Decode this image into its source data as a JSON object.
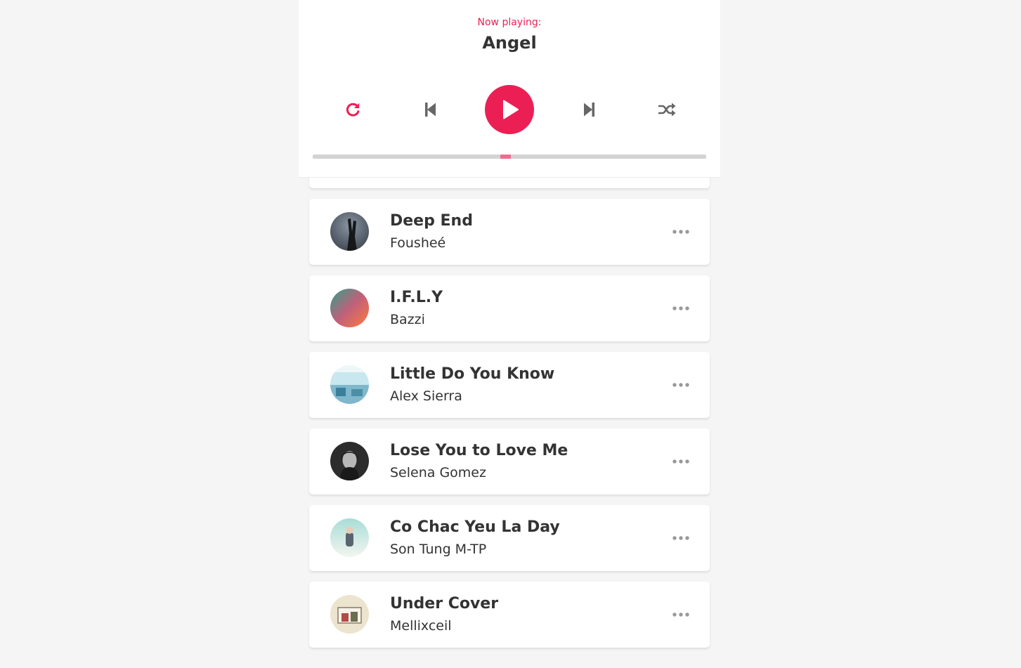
{
  "app": {
    "accent_color": "#ec1f55",
    "background_color": "#f5f5f5"
  },
  "player": {
    "now_playing_label": "Now playing:",
    "current_song": "Angel",
    "progress_fraction": 0.49,
    "controls": {
      "repeat_icon": "repeat-icon",
      "prev_icon": "step-backward-icon",
      "play_icon": "play-icon",
      "next_icon": "step-forward-icon",
      "random_icon": "random-icon"
    }
  },
  "playlist": {
    "songs": [
      {
        "title": "",
        "artist": ""
      },
      {
        "title": "Deep End",
        "artist": "Fousheé"
      },
      {
        "title": "I.F.L.Y",
        "artist": "Bazzi"
      },
      {
        "title": "Little Do You Know",
        "artist": "Alex Sierra"
      },
      {
        "title": "Lose You to Love Me",
        "artist": "Selena Gomez"
      },
      {
        "title": "Co Chac Yeu La Day",
        "artist": "Son Tung M-TP"
      },
      {
        "title": "Under Cover",
        "artist": "Mellixceil"
      }
    ],
    "option_icon": "ellipsis-icon"
  }
}
